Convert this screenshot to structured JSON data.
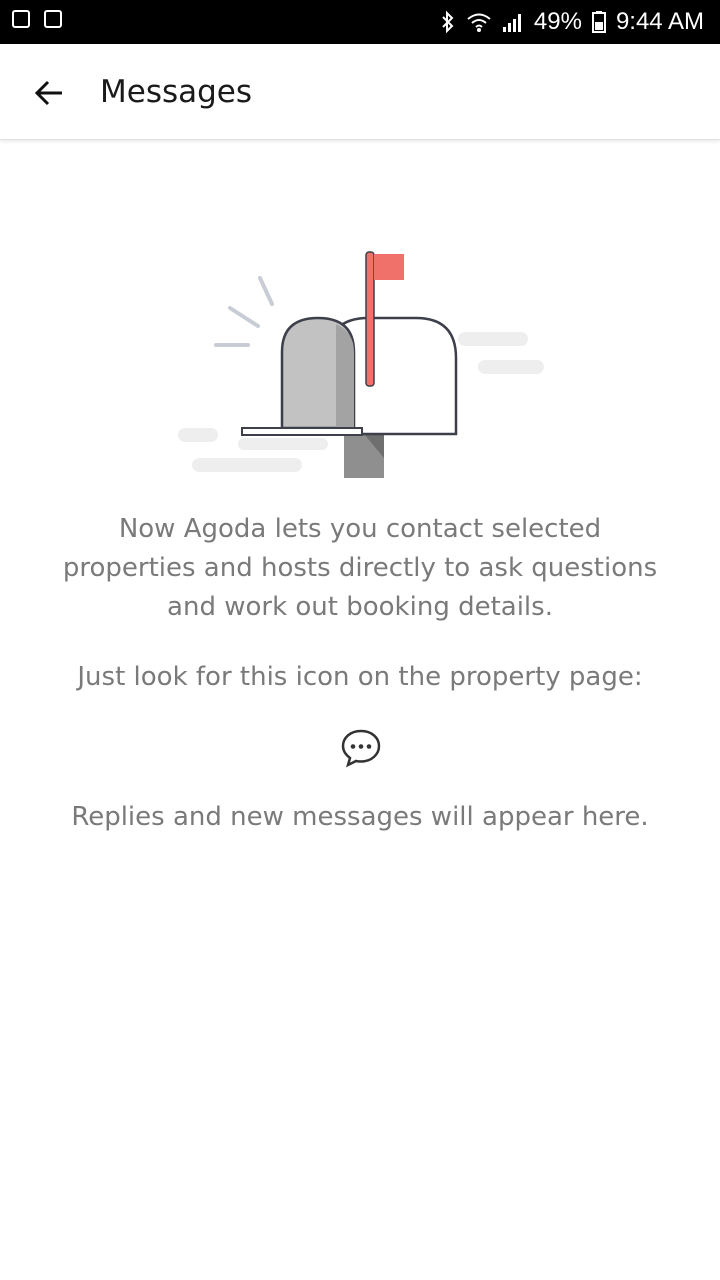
{
  "status_bar": {
    "battery": "49%",
    "time": "9:44 AM"
  },
  "header": {
    "title": "Messages"
  },
  "empty_state": {
    "intro": "Now Agoda lets you contact selected properties and hosts directly to ask questions and work out booking details.",
    "hint": "Just look for this icon on the property page:",
    "replies": "Replies and new messages will appear here."
  },
  "icons": {
    "back": "arrow-left-icon",
    "chat": "chat-bubble-icon",
    "bluetooth": "bluetooth-icon",
    "wifi": "wifi-icon",
    "signal": "signal-icon",
    "battery": "battery-icon"
  },
  "colors": {
    "text_primary": "#1a1a1a",
    "text_secondary": "#7a7a7a",
    "flag": "#f0706a"
  }
}
